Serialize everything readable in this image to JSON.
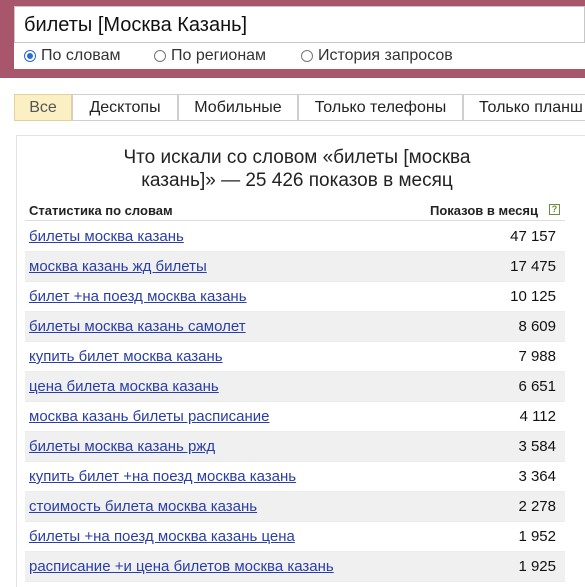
{
  "search": {
    "query": "билеты [Москва Казань]"
  },
  "radios": [
    {
      "label": "По словам",
      "selected": true
    },
    {
      "label": "По регионам",
      "selected": false
    },
    {
      "label": "История запросов",
      "selected": false
    }
  ],
  "tabs": [
    {
      "label": "Все",
      "active": true
    },
    {
      "label": "Десктопы",
      "active": false
    },
    {
      "label": "Мобильные",
      "active": false
    },
    {
      "label": "Только телефоны",
      "active": false
    },
    {
      "label": "Только планш",
      "active": false
    }
  ],
  "panel": {
    "title": "Что искали со словом «билеты [москва казань]» — 25 426 показов в месяц",
    "col_words": "Статистика по словам",
    "col_count": "Показов в месяц",
    "help_glyph": "?"
  },
  "rows": [
    {
      "phrase": "билеты москва казань",
      "count": "47 157"
    },
    {
      "phrase": "москва казань жд билеты",
      "count": "17 475"
    },
    {
      "phrase": "билет +на поезд москва казань",
      "count": "10 125"
    },
    {
      "phrase": "билеты москва казань самолет",
      "count": "8 609"
    },
    {
      "phrase": "купить билет москва казань",
      "count": "7 988"
    },
    {
      "phrase": "цена билета москва казань",
      "count": "6 651"
    },
    {
      "phrase": "москва казань билеты расписание",
      "count": "4 112"
    },
    {
      "phrase": "билеты москва казань ржд",
      "count": "3 584"
    },
    {
      "phrase": "купить билет +на поезд москва казань",
      "count": "3 364"
    },
    {
      "phrase": "стоимость билета москва казань",
      "count": "2 278"
    },
    {
      "phrase": "билеты +на поезд москва казань цена",
      "count": "1 952"
    },
    {
      "phrase": "расписание +и цена билетов москва казань",
      "count": "1 925"
    }
  ]
}
